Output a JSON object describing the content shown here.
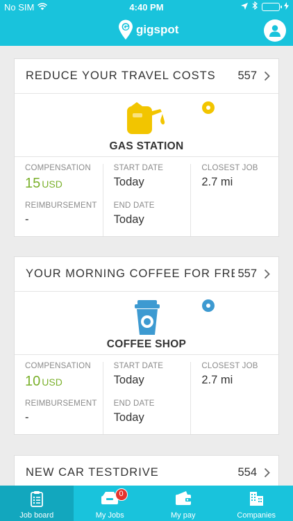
{
  "status_bar": {
    "carrier": "No SIM",
    "time": "4:40 PM",
    "battery_color": "#7cd44a"
  },
  "header": {
    "app_name": "gigspot",
    "brand_color": "#19c3dc"
  },
  "cards": [
    {
      "title": "REDUCE YOUR TRAVEL COSTS",
      "count": "557",
      "category": "GAS STATION",
      "icon": "gas-can-icon",
      "icon_color": "#f2c500",
      "pin_color": "#f2c500",
      "compensation_label": "COMPENSATION",
      "compensation_amount": "15",
      "compensation_currency": "USD",
      "reimbursement_label": "REIMBURSEMENT",
      "reimbursement_value": "-",
      "start_date_label": "START DATE",
      "start_date_value": "Today",
      "end_date_label": "END DATE",
      "end_date_value": "Today",
      "closest_job_label": "CLOSEST JOB",
      "closest_job_value": "2.7 mi"
    },
    {
      "title": "YOUR MORNING COFFEE FOR FREE",
      "count": "557",
      "category": "COFFEE SHOP",
      "icon": "coffee-cup-icon",
      "icon_color": "#3d9ad1",
      "pin_color": "#3d9ad1",
      "compensation_label": "COMPENSATION",
      "compensation_amount": "10",
      "compensation_currency": "USD",
      "reimbursement_label": "REIMBURSEMENT",
      "reimbursement_value": "-",
      "start_date_label": "START DATE",
      "start_date_value": "Today",
      "end_date_label": "END DATE",
      "end_date_value": "Today",
      "closest_job_label": "CLOSEST JOB",
      "closest_job_value": "2.7 mi"
    },
    {
      "title": "NEW CAR TESTDRIVE",
      "count": "554"
    }
  ],
  "tabs": [
    {
      "label": "Job board",
      "icon": "clipboard-icon",
      "active": true
    },
    {
      "label": "My Jobs",
      "icon": "inbox-icon",
      "badge": "0"
    },
    {
      "label": "My pay",
      "icon": "wallet-icon"
    },
    {
      "label": "Companies",
      "icon": "buildings-icon"
    }
  ]
}
